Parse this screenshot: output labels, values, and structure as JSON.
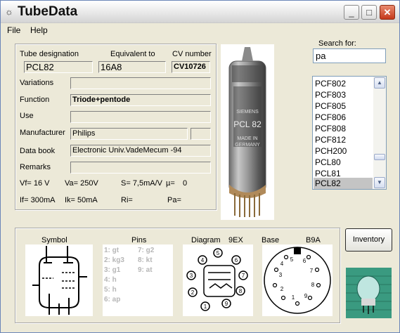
{
  "window": {
    "title": "TubeData",
    "min": "_",
    "max": "□",
    "close": "✕"
  },
  "menu": {
    "file": "File",
    "help": "Help"
  },
  "info": {
    "designation_label": "Tube designation",
    "designation": "PCL82",
    "equivalent_label": "Equivalent to",
    "equivalent": "16A8",
    "cv_label": "CV number",
    "cv": "CV10726",
    "variations_label": "Variations",
    "variations": "",
    "function_label": "Function",
    "function": "Triode+pentode",
    "use_label": "Use",
    "use": "",
    "manufacturer_label": "Manufacturer",
    "manufacturer": "Philips",
    "manufacturer_code": "",
    "databook_label": "Data book",
    "databook": "Electronic Univ.VadeMecum -94",
    "remarks_label": "Remarks",
    "remarks": "",
    "vf": "Vf= 16 V",
    "va": "Va= 250V",
    "s": "S= 7,5mA/V",
    "mu": "µ=",
    "mu_val": "0",
    "if": "If= 300mA",
    "ik": "Ik= 50mA",
    "ri": "Ri=",
    "pa": "Pa="
  },
  "search": {
    "label": "Search for:",
    "value": "pa"
  },
  "list": {
    "items": [
      "PCF802",
      "PCF803",
      "PCF805",
      "PCF806",
      "PCF808",
      "PCF812",
      "PCH200",
      "PCL80",
      "PCL81",
      "PCL82"
    ],
    "selected": "PCL82"
  },
  "tube_image": {
    "brand": "SIEMENS",
    "type": "PCL 82",
    "made1": "MADE IN",
    "made2": "GERMANY"
  },
  "bottom": {
    "symbol_label": "Symbol",
    "pins_label": "Pins",
    "diagram_label": "Diagram",
    "diagram_code": "9EX",
    "base_label": "Base",
    "base_code": "B9A",
    "pins": [
      "1: gt",
      "2: kg3",
      "3: g1",
      "4: h",
      "5: h",
      "6: ap",
      "7: g2",
      "8: kt",
      "9: at"
    ],
    "inventory": "Inventory"
  }
}
